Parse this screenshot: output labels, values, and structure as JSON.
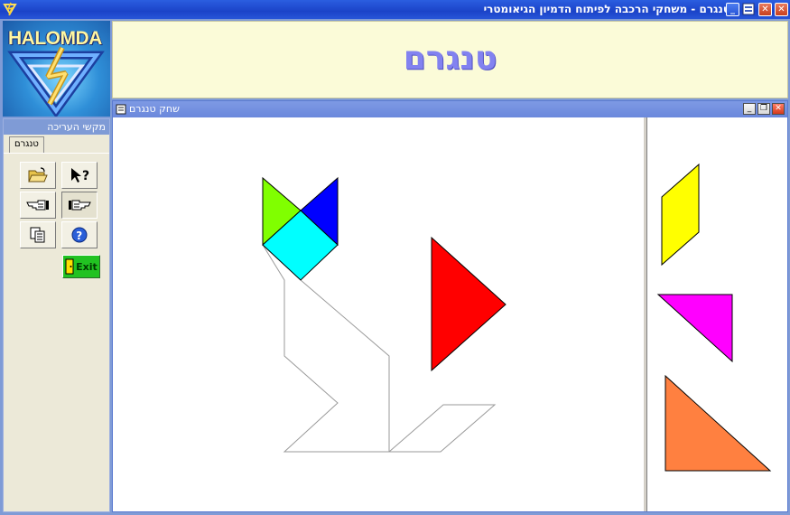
{
  "window": {
    "title": "טנגרם - משחקי הרכבה לפיתוח הדמיון הגיאומטרי",
    "minimize_glyph": "_",
    "maximize_glyph": "□",
    "close_glyph": "✕"
  },
  "logo": {
    "brand": "HALOMDA"
  },
  "banner": {
    "title": "טנגרם"
  },
  "sidebar": {
    "header": "מקשי העריכה",
    "tab": "טנגרם",
    "buttons": [
      {
        "icon": "open-folder-icon"
      },
      {
        "icon": "context-help-icon",
        "glyph": "?"
      },
      {
        "icon": "hand-point-left-icon"
      },
      {
        "icon": "hand-point-right-icon",
        "pressed": true
      },
      {
        "icon": "copy-icon"
      },
      {
        "icon": "help-icon",
        "glyph": "?"
      }
    ],
    "exit_label": "Exit"
  },
  "game_window": {
    "title": "שחק טנגרם",
    "minimize_glyph": "_",
    "restore_glyph": "❐",
    "close_glyph": "✕"
  },
  "colors": {
    "green": "#80ff00",
    "blue": "#0000ff",
    "cyan": "#00ffff",
    "red": "#ff0000",
    "yellow": "#ffff00",
    "magenta": "#ff00ff",
    "orange": "#ff8040",
    "title_bar": "#1b43c8",
    "banner_bg": "#fbfbd8",
    "banner_text": "#8282f0"
  }
}
